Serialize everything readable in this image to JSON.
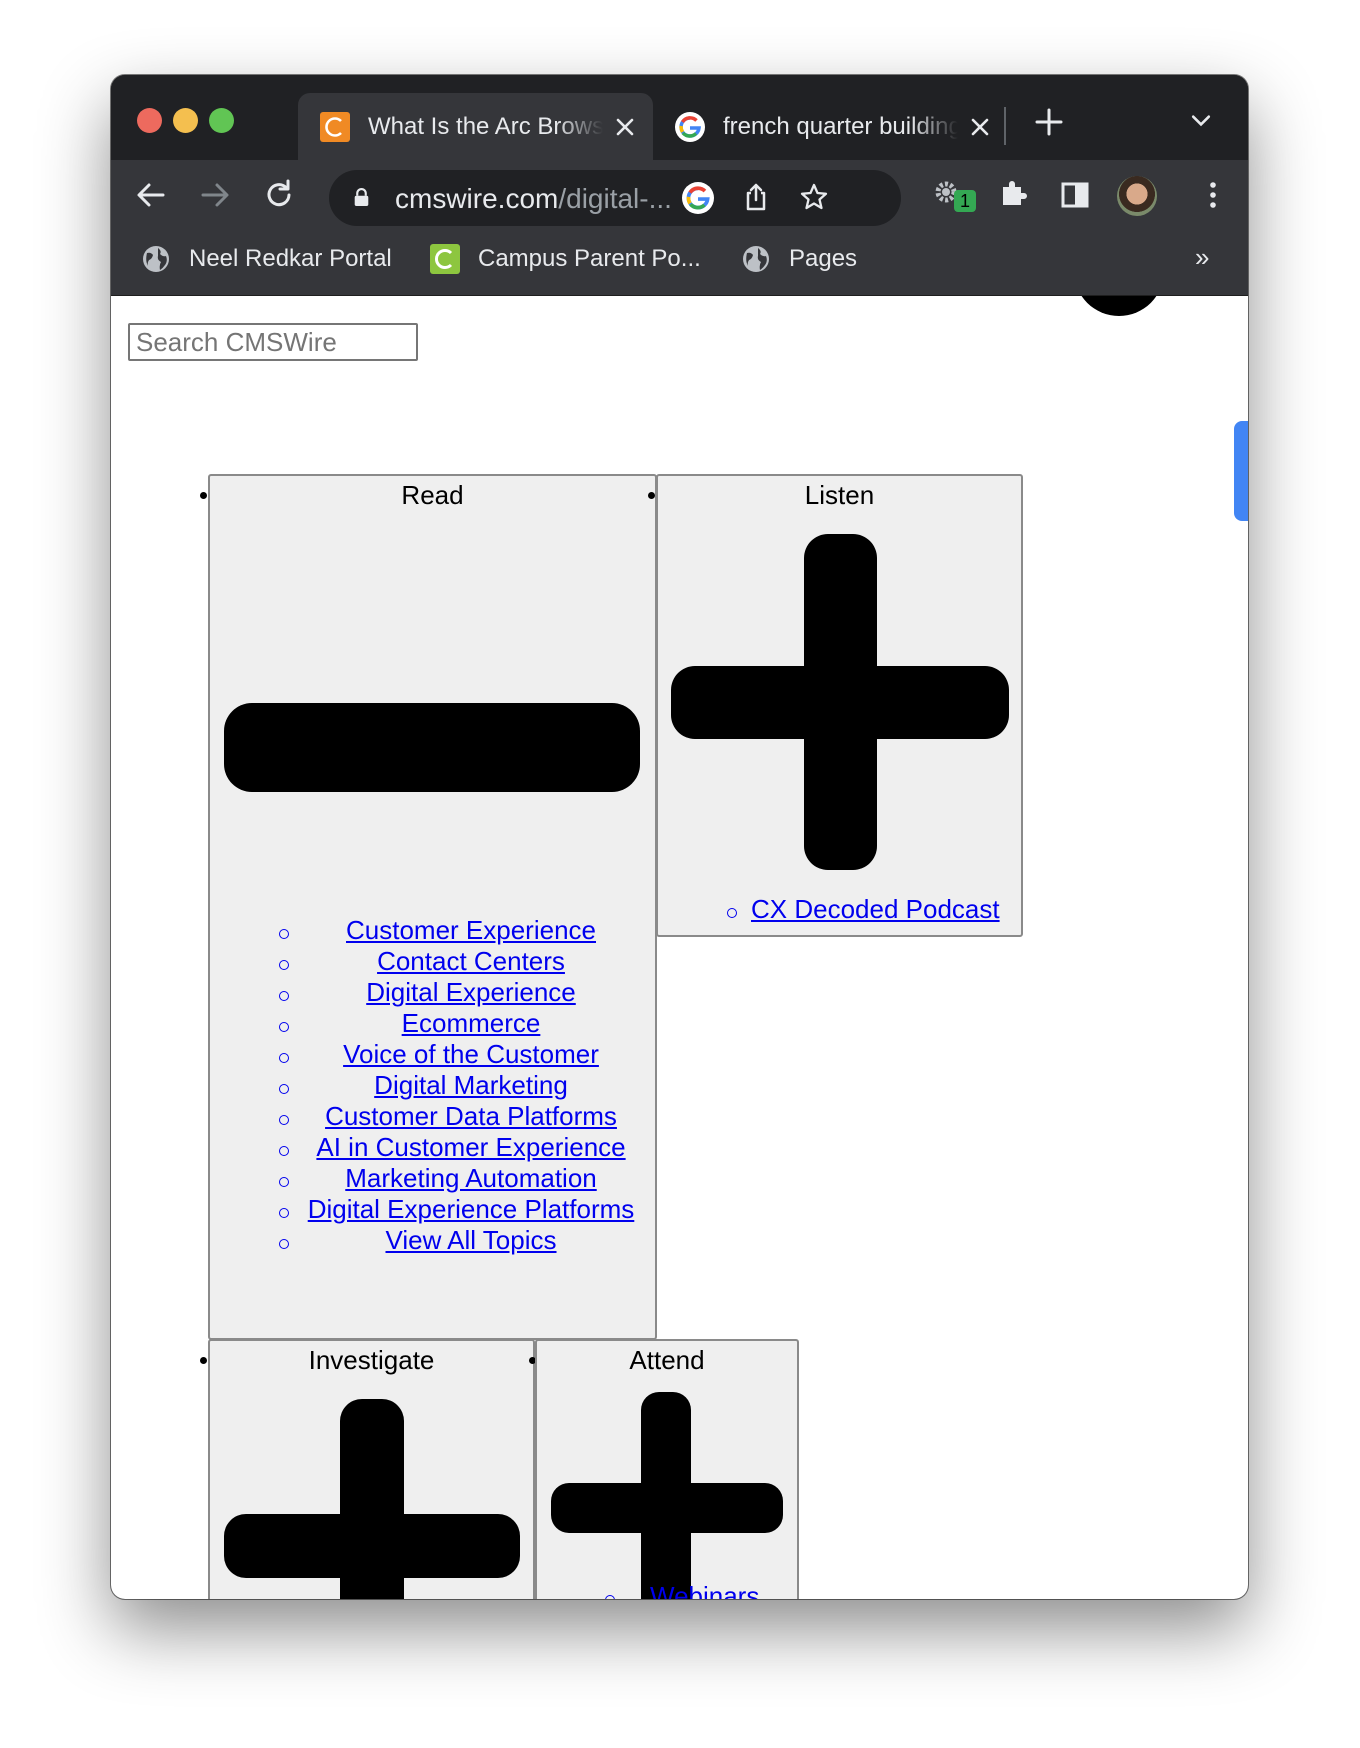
{
  "browser": {
    "tabs": [
      {
        "title": "What Is the Arc Browser",
        "active": true,
        "favicon": "cmswire-c-icon"
      },
      {
        "title": "french quarter buildings",
        "active": false,
        "favicon": "google-g-icon"
      }
    ],
    "address": {
      "domain": "cmswire.com",
      "path": "/digital-..."
    },
    "extension_badge": "1",
    "bookmarks": [
      {
        "label": "Neel Redkar Portal"
      },
      {
        "label": "Campus Parent Po..."
      },
      {
        "label": "Pages"
      }
    ],
    "bookmarks_overflow": "»"
  },
  "page": {
    "search_placeholder": "Search CMSWire",
    "sections": {
      "read": {
        "title": "Read",
        "links": [
          "Customer Experience",
          "Contact Centers",
          "Digital Experience",
          "Ecommerce",
          "Voice of the Customer",
          "Digital Marketing",
          "Customer Data Platforms",
          "AI in Customer Experience",
          "Marketing Automation",
          "Digital Experience Platforms",
          "View All Topics"
        ]
      },
      "listen": {
        "title": "Listen",
        "links": [
          "CX Decoded Podcast"
        ]
      },
      "investigate": {
        "title": "Investigate"
      },
      "attend": {
        "title": "Attend",
        "links": [
          "Webinars"
        ]
      }
    }
  },
  "colors": {
    "link": "#0000ee",
    "panel_bg": "#efefef",
    "browser_dark": "#202124",
    "toolbar": "#35363a"
  }
}
